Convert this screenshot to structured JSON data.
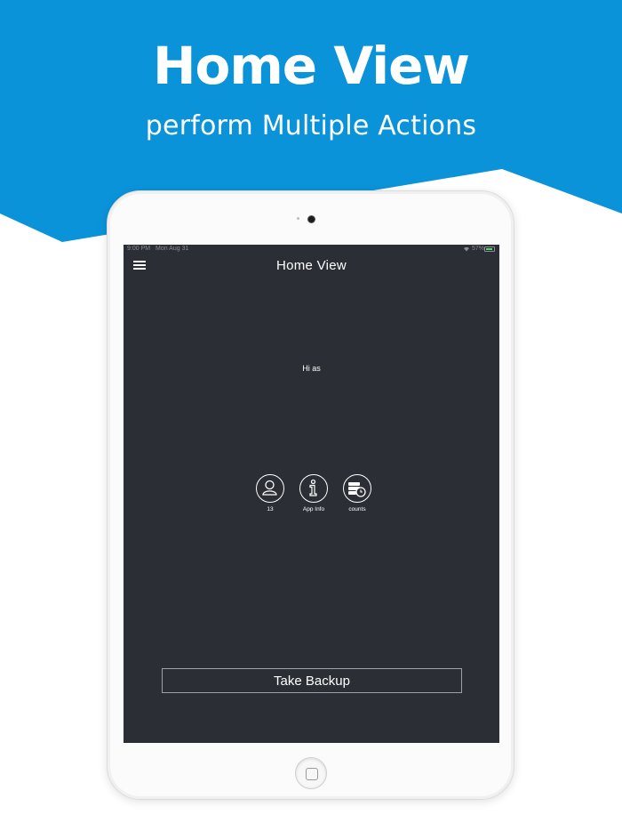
{
  "colors": {
    "brand_blue": "#0b93d9",
    "screen_bg": "#2c2e35",
    "device_frame": "#fbfbfb"
  },
  "promo": {
    "headline": "Home View",
    "subheadline": "perform Multiple Actions"
  },
  "statusbar": {
    "time": "9:00 PM",
    "date": "Mon Aug 31",
    "battery": "57%",
    "icons": [
      "wifi-icon",
      "battery-icon"
    ]
  },
  "navbar": {
    "title": "Home View",
    "menu_icon": "hamburger-menu-icon"
  },
  "greeting": "Hi as",
  "actions": [
    {
      "label": "13",
      "icon": "user-icon"
    },
    {
      "label": "App Info",
      "icon": "info-icon"
    },
    {
      "label": "counts",
      "icon": "database-clock-icon"
    }
  ],
  "backup_button": {
    "label": "Take Backup"
  }
}
